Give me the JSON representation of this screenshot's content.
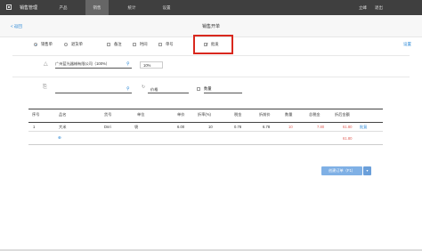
{
  "app": {
    "title": "销售管理"
  },
  "nav": {
    "items": [
      "产品",
      "销售",
      "统计",
      "设置"
    ],
    "active": "销售"
  },
  "user": {
    "name": "立峰",
    "logout": "退出"
  },
  "subheader": {
    "back": "返回",
    "title": "销售开单",
    "settings": "设置"
  },
  "options": {
    "sale": "销售单",
    "return": "退货单",
    "remark": "备注",
    "time": "时间",
    "unit_no": "单号",
    "bulk": "批发"
  },
  "customer": {
    "name": "广州蓝光器械有限公司（100%）",
    "discount": "10%"
  },
  "product": {
    "price_label": "价格",
    "qty_label": "数量"
  },
  "table": {
    "headers": [
      "序号",
      "品名",
      "货号",
      "单位",
      "单价",
      "折率(%)",
      "税金",
      "折前价",
      "数量",
      "总税金",
      "折后金额"
    ],
    "row": {
      "index": "1",
      "name": "大米",
      "code": "Dnri",
      "unit": "袋",
      "price": "6.00",
      "discount": "10",
      "tax": "0.78",
      "pre_price": "6.78",
      "qty": "10",
      "total_tax": "7.80",
      "amount": "61.80",
      "action": "批复"
    },
    "total_amount": "61.80"
  },
  "actions": {
    "create": "创建订单（F1）"
  },
  "colors": {
    "accent": "#2a87d6",
    "highlight": "#d9281e",
    "topbar": "#3f3f3f"
  }
}
